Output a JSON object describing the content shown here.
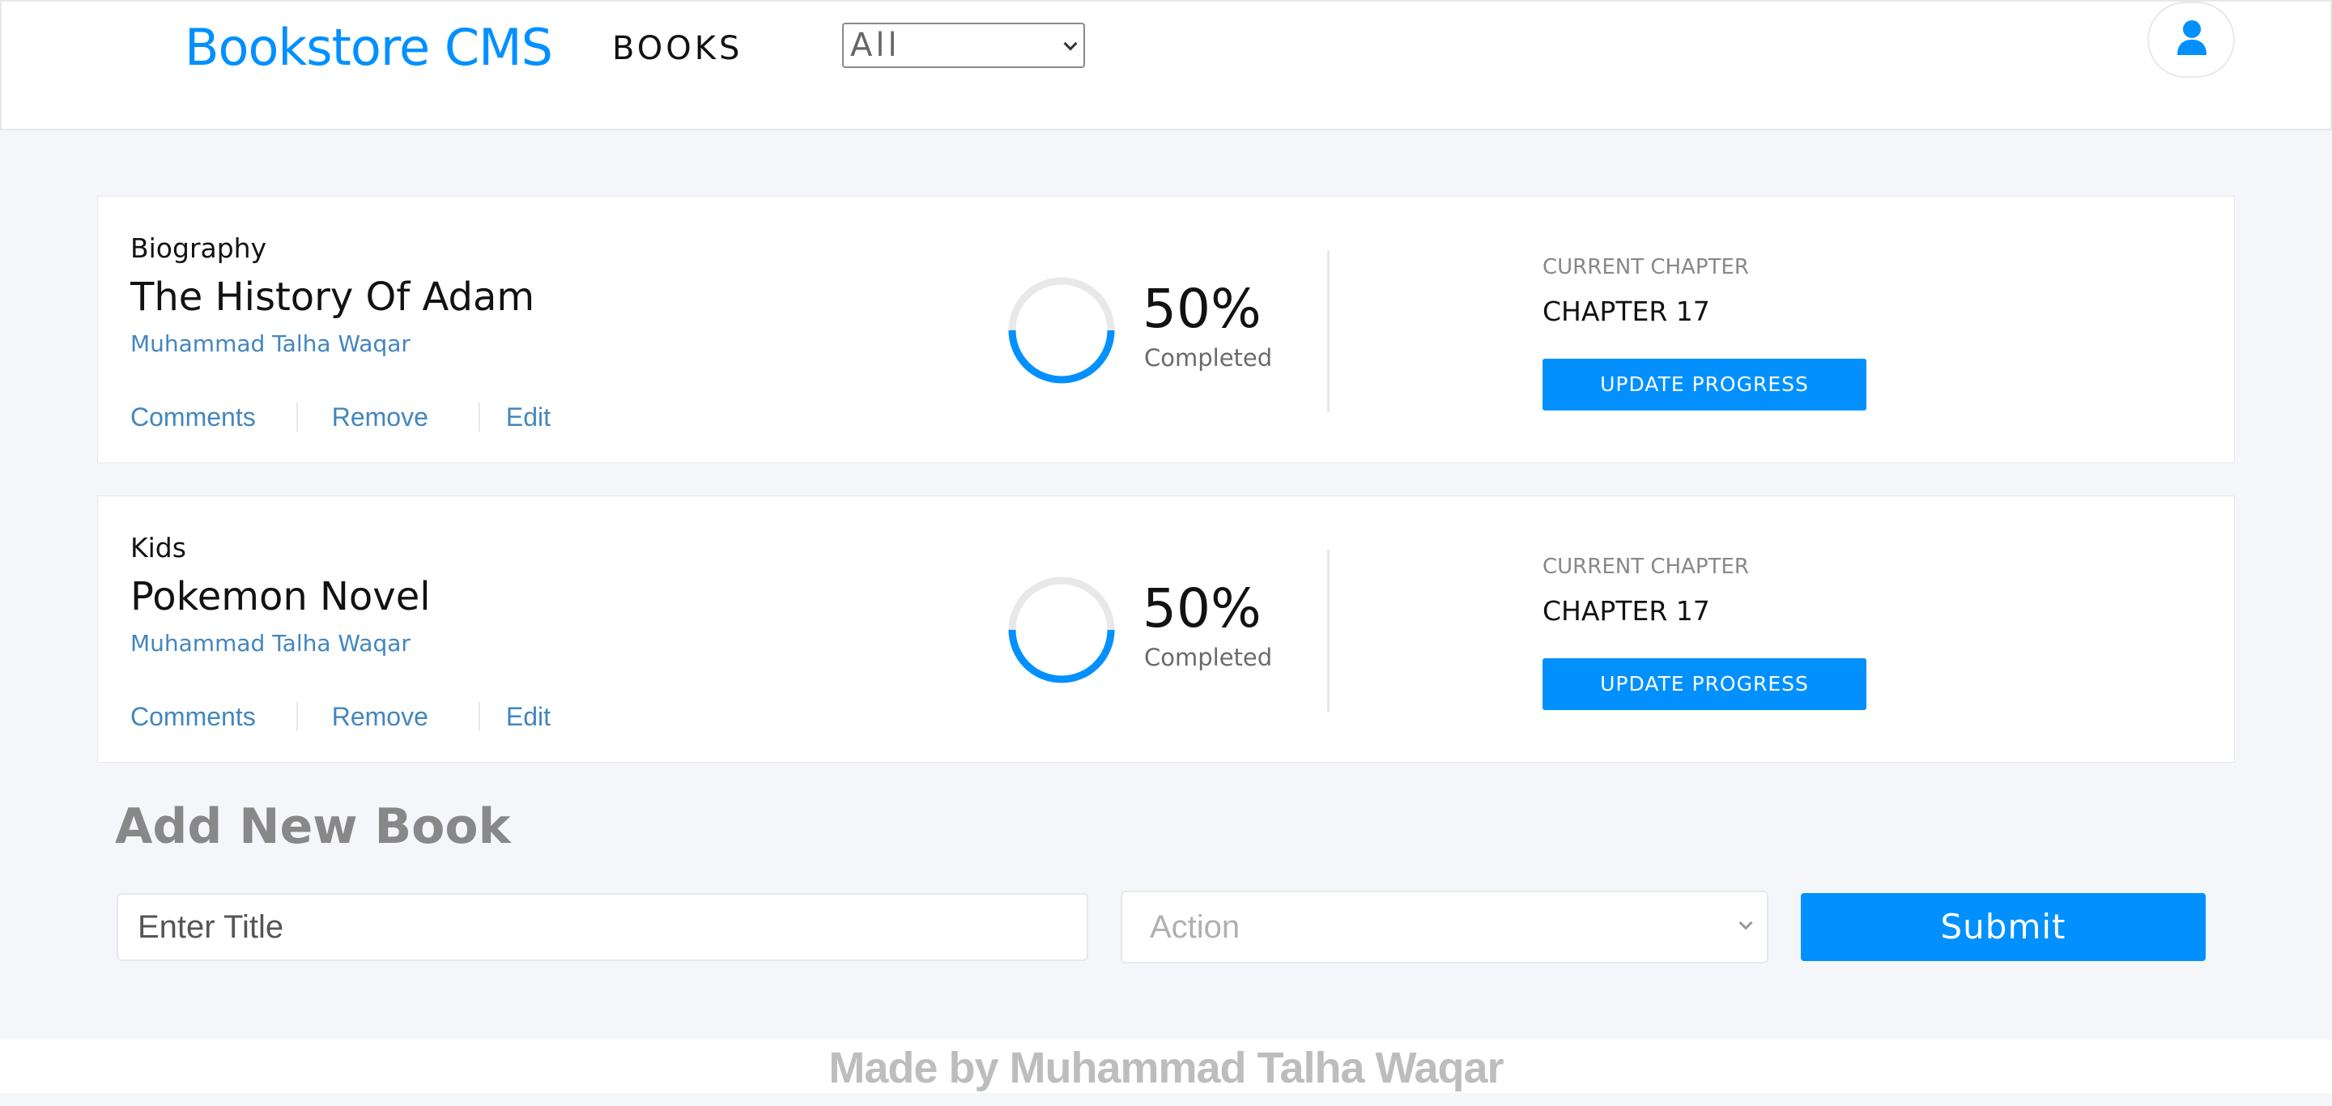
{
  "header": {
    "brand": "Bookstore CMS",
    "nav_books": "BOOKS",
    "filter_value": "All",
    "avatar_icon": "user-icon"
  },
  "books": [
    {
      "genre": "Biography",
      "title": "The History Of Adam",
      "author": "Muhammad Talha Waqar",
      "actions": [
        "Comments",
        "Remove",
        "Edit"
      ],
      "percent": "50%",
      "progress": 0.5,
      "completed_label": "Completed",
      "current_chapter_label": "CURRENT CHAPTER",
      "current_chapter": "CHAPTER 17",
      "update_label": "UPDATE PROGRESS"
    },
    {
      "genre": "Kids",
      "title": "Pokemon Novel",
      "author": "Muhammad Talha Waqar",
      "actions": [
        "Comments",
        "Remove",
        "Edit"
      ],
      "percent": "50%",
      "progress": 0.5,
      "completed_label": "Completed",
      "current_chapter_label": "CURRENT CHAPTER",
      "current_chapter": "CHAPTER 17",
      "update_label": "UPDATE PROGRESS"
    }
  ],
  "add_book": {
    "heading": "Add New Book",
    "title_placeholder": "Enter Title",
    "action_placeholder": "Action",
    "submit_label": "Submit"
  },
  "footer": {
    "text": "Made by Muhammad Talha Waqar"
  },
  "colors": {
    "accent": "#0290ff",
    "link": "#4386bf",
    "background": "#f5f6fa",
    "ring_track": "#e8e8e8",
    "ring_progress": "#0290ff"
  }
}
